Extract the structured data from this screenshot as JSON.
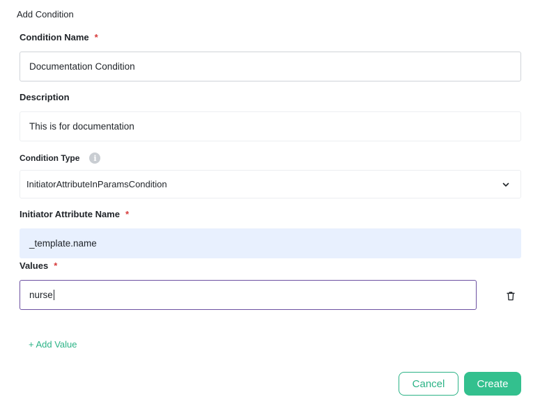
{
  "dialog": {
    "title": "Add Condition"
  },
  "fields": {
    "condition_name": {
      "label": "Condition Name",
      "required_mark": "*",
      "value": "Documentation Condition"
    },
    "description": {
      "label": "Description",
      "value": "This is for documentation"
    },
    "condition_type": {
      "label": "Condition Type",
      "info_icon": "i",
      "value": "InitiatorAttributeInParamsCondition"
    },
    "initiator_attribute_name": {
      "label": "Initiator Attribute Name",
      "required_mark": "*",
      "value": "_template.name"
    },
    "values": {
      "label": "Values",
      "required_mark": "*",
      "items": [
        "nurse"
      ]
    }
  },
  "actions": {
    "add_value": "+ Add Value",
    "cancel": "Cancel",
    "create": "Create"
  },
  "colors": {
    "accent": "#33c08e",
    "required": "#d63a3a",
    "focus_border": "#6b4fa0",
    "autofill_bg": "#e8f0fe"
  }
}
